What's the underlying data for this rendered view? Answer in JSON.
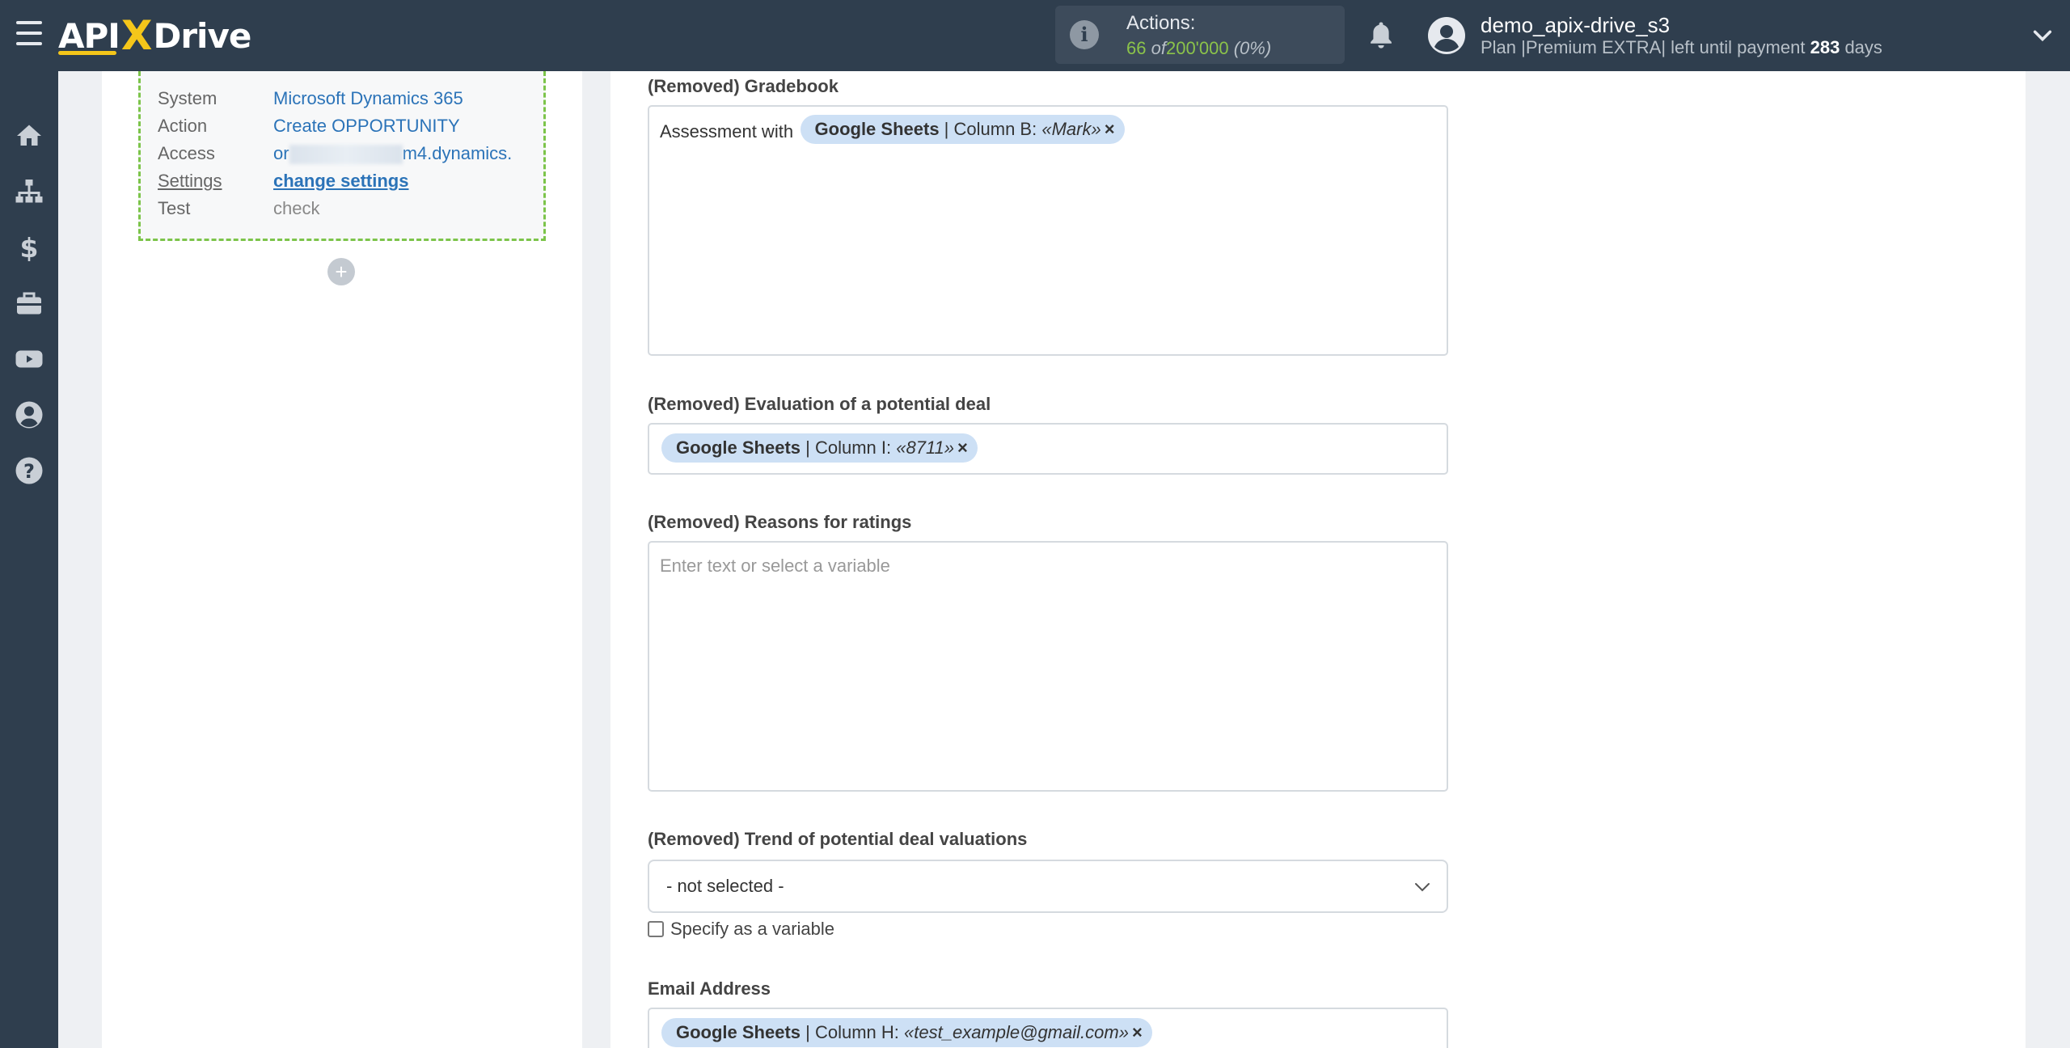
{
  "header": {
    "logo_left": "API",
    "logo_x": "X",
    "logo_right": "Drive",
    "actions_label": "Actions:",
    "actions_used": "66",
    "actions_of": "of",
    "actions_total": "200'000",
    "actions_pct": "(0%)",
    "user_name": "demo_apix-drive_s3",
    "plan_prefix": "Plan |Premium EXTRA| left until payment",
    "plan_days": "283",
    "plan_suffix": "days"
  },
  "sidebar": {
    "items": [
      "home-icon",
      "sitemap-icon",
      "dollar-icon",
      "briefcase-icon",
      "youtube-icon",
      "user-icon",
      "help-icon"
    ]
  },
  "info_card": {
    "system_label": "System",
    "system_value": "Microsoft Dynamics 365",
    "action_label": "Action",
    "action_value": "Create OPPORTUNITY",
    "access_label": "Access",
    "access_value_start": "or",
    "access_value_end": "m4.dynamics.",
    "settings_label": "Settings",
    "settings_value": "change settings",
    "test_label": "Test",
    "test_value": "check"
  },
  "form": {
    "gradebook_label": "(Removed) Gradebook",
    "gradebook_prefix": "Assessment with",
    "gradebook_chip_source": "Google Sheets",
    "gradebook_chip_column": " | Column B: ",
    "gradebook_chip_value": "«Mark»",
    "evaluation_label": "(Removed) Evaluation of a potential deal",
    "evaluation_chip_source": "Google Sheets",
    "evaluation_chip_column": " | Column I: ",
    "evaluation_chip_value": "«8711»",
    "reasons_label": "(Removed) Reasons for ratings",
    "reasons_placeholder": "Enter text or select a variable",
    "trend_label": "(Removed) Trend of potential deal valuations",
    "trend_value": "- not selected -",
    "specify_variable": "Specify as a variable",
    "email_label": "Email Address",
    "email_chip_source": "Google Sheets",
    "email_chip_column": " | Column H: ",
    "email_chip_value": "«test_example@gmail.com»",
    "chip_remove": "×"
  },
  "colors": {
    "topbar": "#2f3e4e",
    "accent_yellow": "#f5c61a",
    "link_blue": "#2b73b8",
    "chip_bg": "#cde0f5",
    "dashed_green": "#7cc44a"
  }
}
